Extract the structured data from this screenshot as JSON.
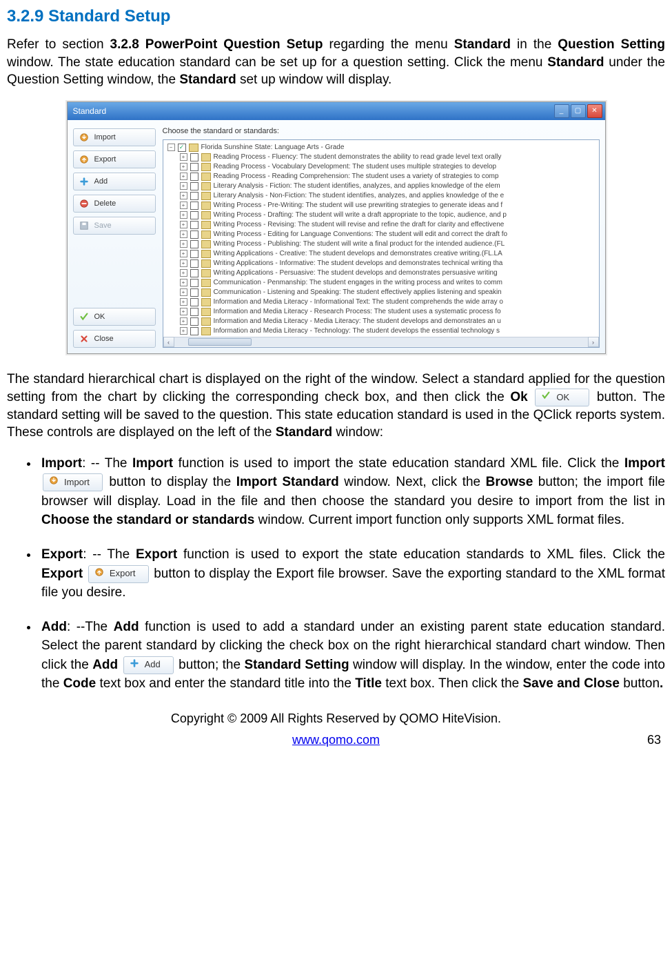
{
  "section": {
    "number": "3.2.9",
    "title": "Standard Setup"
  },
  "intro": {
    "t1": "Refer to section ",
    "b1": "3.2.8 PowerPoint Question Setup",
    "t2": " regarding the menu ",
    "b2": "Standard",
    "t3": " in the ",
    "b3": "Question Setting",
    "t4": " window. The state education standard can be set up for a question setting. Click the menu ",
    "b4": "Standard",
    "t5": " under the Question Setting window, the ",
    "b5": "Standard",
    "t6": " set up window will display."
  },
  "window": {
    "title": "Standard",
    "chooseLabel": "Choose the standard or standards:",
    "buttons": {
      "import": "Import",
      "export": "Export",
      "add": "Add",
      "delete": "Delete",
      "save": "Save",
      "ok": "OK",
      "close": "Close"
    },
    "root": "Florida Sunshine State: Language Arts - Grade",
    "items": [
      "Reading Process - Fluency: The student demonstrates the ability to read grade level text orally",
      "Reading Process - Vocabulary Development: The student uses multiple strategies to develop",
      "Reading Process - Reading Comprehension: The student uses a variety of strategies to comp",
      "Literary Analysis - Fiction: The student identifies, analyzes, and applies knowledge of the elem",
      "Literary Analysis - Non-Fiction: The student identifies, analyzes, and applies knowledge of the e",
      "Writing Process - Pre-Writing: The student will use prewriting strategies to generate ideas and f",
      "Writing Process - Drafting: The student will write a draft appropriate to the topic, audience, and p",
      "Writing Process - Revising: The student will revise and refine the draft for clarity and effectivene",
      "Writing Process - Editing for Language Conventions: The student will edit and correct the draft fo",
      "Writing Process - Publishing: The student will write a final product for the intended audience.(FL",
      "Writing Applications - Creative: The student develops and demonstrates creative writing.(FL.LA",
      "Writing Applications - Informative: The student develops and demonstrates technical writing tha",
      "Writing Applications - Persuasive: The student develops and demonstrates persuasive writing",
      "Communication - Penmanship: The student engages in the writing process and writes to comm",
      "Communication - Listening and Speaking: The student effectively applies listening and speakin",
      "Information and Media Literacy - Informational Text: The student comprehends the wide array o",
      "Information and Media Literacy - Research Process: The student uses a systematic process fo",
      "Information and Media Literacy - Media Literacy: The student develops and demonstrates an u",
      "Information and Media Literacy - Technology: The student develops the essential technology s"
    ]
  },
  "para2": {
    "t1": "The standard hierarchical chart is displayed on the right of the window. Select a standard applied for the question setting from the chart by clicking the corresponding check box, and then click the ",
    "b1": "Ok",
    "okBtnLabel": "OK",
    "t2": " button. The standard setting will be saved to the question. This state education standard is used in the QClick reports system. These controls are displayed on the left of the ",
    "b2": "Standard",
    "t3": " window:"
  },
  "bullets": {
    "import": {
      "name": "Import",
      "t1": ": -- The ",
      "b1": "Import",
      "t2": " function is used to import the state education standard XML file. Click the ",
      "b2": "Import",
      "btnLabel": "Import",
      "t3": " button to display the ",
      "b3": "Import Standard",
      "t4": " window. Next, click the ",
      "b4": "Browse",
      "t5": " button; the import file browser will display. Load in the file and then choose the standard you desire to import from the list in ",
      "b5": "Choose the standard or standards",
      "t6": " window. Current import function only supports XML format files."
    },
    "export": {
      "name": "Export",
      "t1": ": -- The ",
      "b1": "Export",
      "t2": " function is used to export the state education standards to XML files. Click the ",
      "b2": "Export",
      "btnLabel": "Export",
      "t3": " button to display the Export file browser. Save the exporting standard to the XML format file you desire."
    },
    "add": {
      "name": "Add",
      "t1": ": --The ",
      "b1": "Add",
      "t2": " function is used to add a standard under an existing parent state education standard. Select the parent standard by clicking the check box on the right hierarchical standard chart window. Then click the ",
      "b2": "Add",
      "btnLabel": "Add",
      "t3": " button; the ",
      "b3": "Standard Setting",
      "t4": " window will display. In the window, enter the code into the ",
      "b4": "Code",
      "t5": " text box and enter the standard title into the ",
      "b5": "Title",
      "t6": " text box. Then click the ",
      "b6": "Save and Close",
      "t7": " button",
      "b7": "."
    }
  },
  "footer": {
    "copyright": "Copyright © 2009 All Rights Reserved by QOMO HiteVision.",
    "url": "www.qomo.com",
    "page": "63"
  }
}
